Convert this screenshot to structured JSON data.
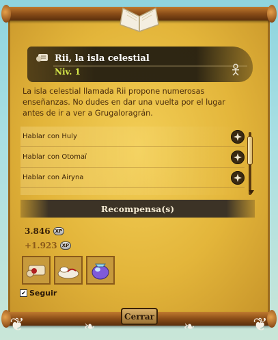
{
  "quest": {
    "title": "Rii, la isla celestial",
    "level": "Niv. 1",
    "description": "La isla celestial llamada Rii propone numerosas enseñanzas. No dudes en dar una vuelta por el lugar antes de ir a ver a Grugaloragrán."
  },
  "dialogs": [
    {
      "label": "Hablar con Huly"
    },
    {
      "label": "Hablar con Otomaï"
    },
    {
      "label": "Hablar con Airyna"
    },
    {
      "label": ""
    }
  ],
  "rewards": {
    "header": "Recompensa(s)",
    "xp": "3.846",
    "bonus_xp": "+1.923",
    "xp_badge": "XP",
    "items": [
      {
        "icon": "scroll-icon"
      },
      {
        "icon": "bed-icon"
      },
      {
        "icon": "gem-bag-icon"
      }
    ]
  },
  "follow_label": "Seguir",
  "follow_checked": true,
  "close_label": "Cerrar",
  "colors": {
    "parchment": "#e3b53a",
    "header_band": "#3c3326",
    "level_text": "#d6e84a"
  }
}
